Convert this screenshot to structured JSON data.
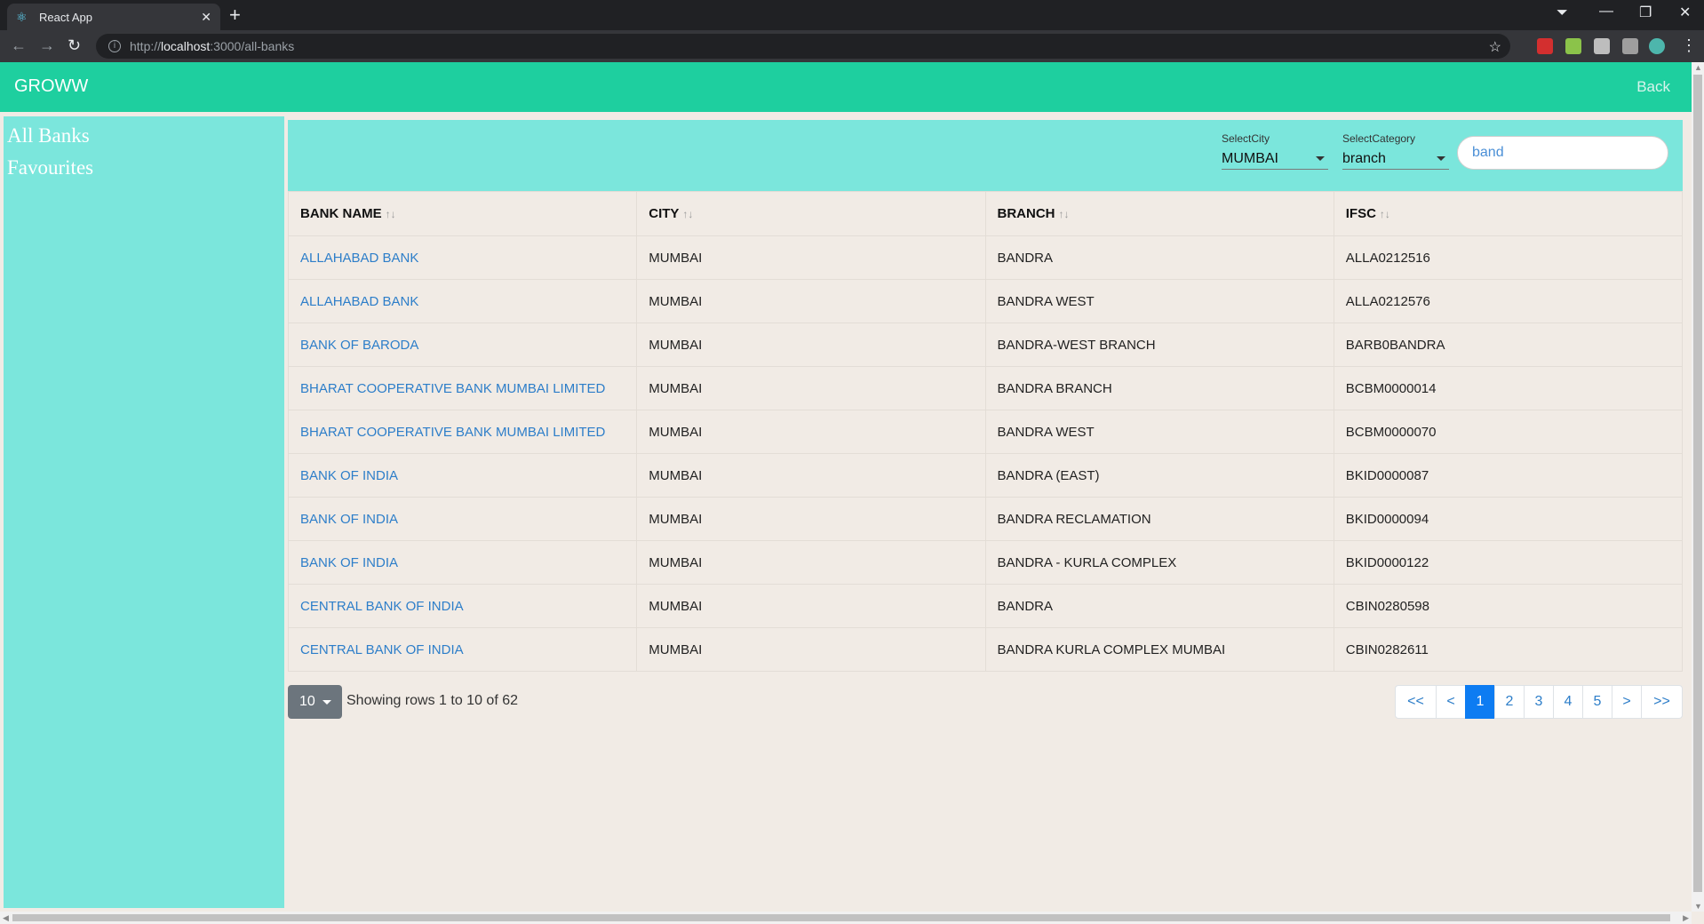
{
  "browser": {
    "tab_title": "React App",
    "url_prefix": "http://",
    "url_host": "localhost",
    "url_rest": ":3000/all-banks"
  },
  "app": {
    "brand": "GROWW",
    "back": "Back"
  },
  "sidebar": {
    "items": [
      {
        "label": "All Banks"
      },
      {
        "label": "Favourites"
      }
    ]
  },
  "filters": {
    "city_label": "SelectCity",
    "city_value": "MUMBAI",
    "category_label": "SelectCategory",
    "category_value": "branch",
    "search_value": "band"
  },
  "table": {
    "headers": [
      "BANK NAME",
      "CITY",
      "BRANCH",
      "IFSC"
    ],
    "sort_glyph": "↑↓",
    "rows": [
      {
        "bank": "ALLAHABAD BANK",
        "city": "MUMBAI",
        "branch": "BANDRA",
        "ifsc": "ALLA0212516"
      },
      {
        "bank": "ALLAHABAD BANK",
        "city": "MUMBAI",
        "branch": "BANDRA WEST",
        "ifsc": "ALLA0212576"
      },
      {
        "bank": "BANK OF BARODA",
        "city": "MUMBAI",
        "branch": "BANDRA-WEST BRANCH",
        "ifsc": "BARB0BANDRA"
      },
      {
        "bank": "BHARAT COOPERATIVE BANK MUMBAI LIMITED",
        "city": "MUMBAI",
        "branch": "BANDRA BRANCH",
        "ifsc": "BCBM0000014"
      },
      {
        "bank": "BHARAT COOPERATIVE BANK MUMBAI LIMITED",
        "city": "MUMBAI",
        "branch": "BANDRA WEST",
        "ifsc": "BCBM0000070"
      },
      {
        "bank": "BANK OF INDIA",
        "city": "MUMBAI",
        "branch": "BANDRA (EAST)",
        "ifsc": "BKID0000087"
      },
      {
        "bank": "BANK OF INDIA",
        "city": "MUMBAI",
        "branch": "BANDRA RECLAMATION",
        "ifsc": "BKID0000094"
      },
      {
        "bank": "BANK OF INDIA",
        "city": "MUMBAI",
        "branch": "BANDRA - KURLA COMPLEX",
        "ifsc": "BKID0000122"
      },
      {
        "bank": "CENTRAL BANK OF INDIA",
        "city": "MUMBAI",
        "branch": "BANDRA",
        "ifsc": "CBIN0280598"
      },
      {
        "bank": "CENTRAL BANK OF INDIA",
        "city": "MUMBAI",
        "branch": "BANDRA KURLA COMPLEX MUMBAI",
        "ifsc": "CBIN0282611"
      }
    ]
  },
  "footer": {
    "page_size": "10",
    "showing": "Showing rows 1 to 10 of 62",
    "pages": [
      "<<",
      "<",
      "1",
      "2",
      "3",
      "4",
      "5",
      ">",
      ">>"
    ],
    "active_page": "1"
  },
  "colors": {
    "appbar": "#1ecf9f",
    "sidebar": "#7be6dc",
    "link": "#2d7ec9",
    "active_page": "#0d7cf2"
  }
}
